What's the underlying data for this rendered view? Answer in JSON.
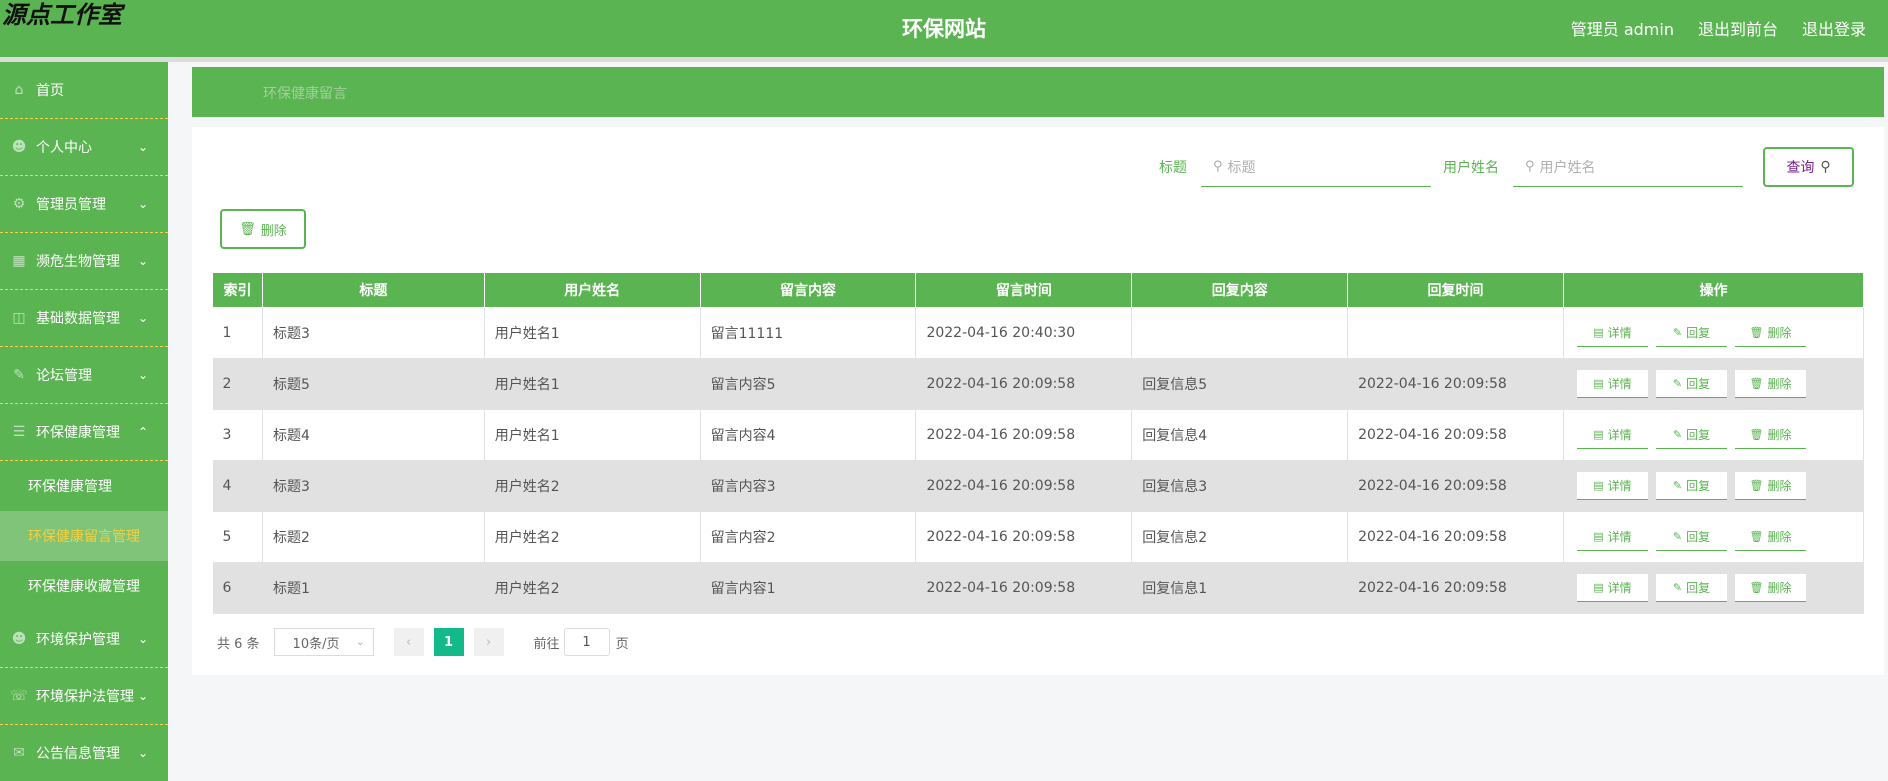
{
  "header": {
    "brand": "源点工作室",
    "title": "环保网站",
    "admin": "管理员 admin",
    "front": "退出到前台",
    "logout": "退出登录"
  },
  "sidebar": {
    "items": [
      {
        "label": "首页",
        "icon": "home-icon"
      },
      {
        "label": "个人中心",
        "icon": "user-icon",
        "expandable": true
      },
      {
        "label": "管理员管理",
        "icon": "admin-icon",
        "expandable": true
      },
      {
        "label": "濒危生物管理",
        "icon": "grid-icon",
        "expandable": true
      },
      {
        "label": "基础数据管理",
        "icon": "database-icon",
        "expandable": true
      },
      {
        "label": "论坛管理",
        "icon": "forum-icon",
        "expandable": true
      },
      {
        "label": "环保健康管理",
        "icon": "menu-icon",
        "expandable": true,
        "expanded": true
      }
    ],
    "sub_items": [
      {
        "label": "环保健康管理"
      },
      {
        "label": "环保健康留言管理",
        "active": true
      },
      {
        "label": "环保健康收藏管理"
      }
    ],
    "items_after": [
      {
        "label": "环境保护管理",
        "icon": "user-icon"
      },
      {
        "label": "环境保护法管理",
        "icon": "phone-icon"
      },
      {
        "label": "公告信息管理",
        "icon": "mail-icon"
      }
    ]
  },
  "breadcrumb": "环保健康留言",
  "search": {
    "title_label": "标题",
    "title_placeholder": "标题",
    "user_label": "用户姓名",
    "user_placeholder": "用户姓名",
    "query": "查询"
  },
  "delete_label": "删除",
  "table": {
    "headers": [
      "索引",
      "标题",
      "用户姓名",
      "留言内容",
      "留言时间",
      "回复内容",
      "回复时间",
      "操作"
    ],
    "rows": [
      [
        "1",
        "标题3",
        "用户姓名1",
        "留言11111",
        "2022-04-16 20:40:30",
        "",
        ""
      ],
      [
        "2",
        "标题5",
        "用户姓名1",
        "留言内容5",
        "2022-04-16 20:09:58",
        "回复信息5",
        "2022-04-16 20:09:58"
      ],
      [
        "3",
        "标题4",
        "用户姓名1",
        "留言内容4",
        "2022-04-16 20:09:58",
        "回复信息4",
        "2022-04-16 20:09:58"
      ],
      [
        "4",
        "标题3",
        "用户姓名2",
        "留言内容3",
        "2022-04-16 20:09:58",
        "回复信息3",
        "2022-04-16 20:09:58"
      ],
      [
        "5",
        "标题2",
        "用户姓名2",
        "留言内容2",
        "2022-04-16 20:09:58",
        "回复信息2",
        "2022-04-16 20:09:58"
      ],
      [
        "6",
        "标题1",
        "用户姓名2",
        "留言内容1",
        "2022-04-16 20:09:58",
        "回复信息1",
        "2022-04-16 20:09:58"
      ]
    ],
    "actions": {
      "detail": "详情",
      "reply": "回复",
      "delete": "删除"
    }
  },
  "pagination": {
    "total": "共 6 条",
    "page_size": "10条/页",
    "current": "1",
    "goto_label": "前往",
    "goto_value": "1",
    "page_suffix": "页"
  },
  "colors": {
    "primary": "#5bb452",
    "active_text": "#f5d040",
    "page_active": "#14b98a"
  }
}
